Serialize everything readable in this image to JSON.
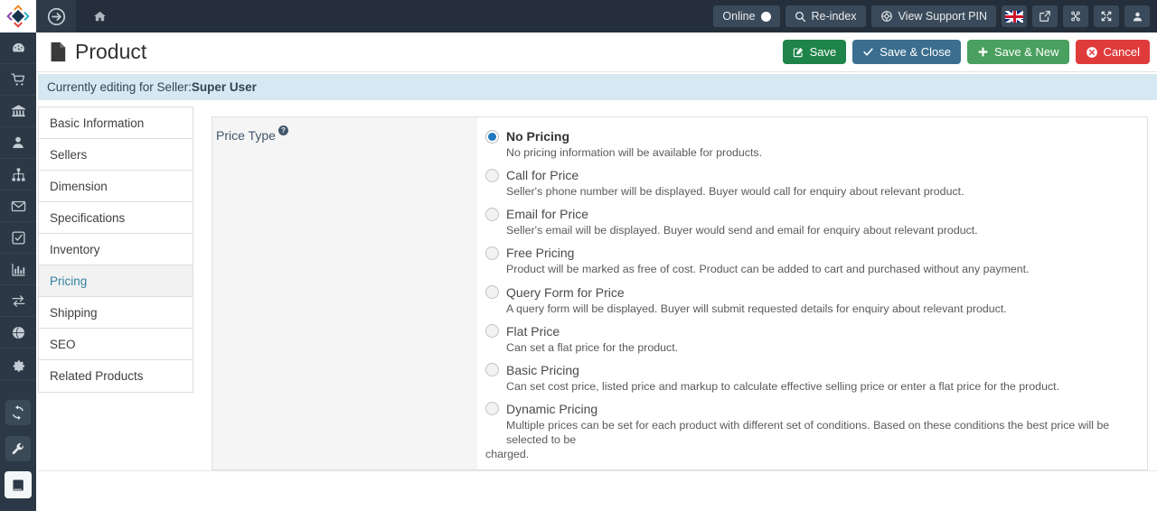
{
  "topbar": {
    "online_label": "Online",
    "reindex_label": "Re-index",
    "support_pin_label": "View Support PIN",
    "icons": {
      "forward": "arrow-circle-right-icon",
      "home": "home-icon",
      "search": "search-icon",
      "globe": "lifebuoy-icon",
      "flag": "uk-flag-icon",
      "external": "external-link-icon",
      "joomla": "joomla-icon",
      "expand": "expand-icon",
      "user": "user-icon"
    }
  },
  "header": {
    "title": "Product",
    "save_label": "Save",
    "save_close_label": "Save & Close",
    "save_new_label": "Save & New",
    "cancel_label": "Cancel"
  },
  "notice": {
    "prefix": "Currently editing for Seller: ",
    "seller": "Super User"
  },
  "rail": {
    "items": [
      {
        "name": "dashboard-icon"
      },
      {
        "name": "cart-icon"
      },
      {
        "name": "bank-icon"
      },
      {
        "name": "user-icon"
      },
      {
        "name": "sitemap-icon"
      },
      {
        "name": "envelope-icon"
      },
      {
        "name": "check-square-icon"
      },
      {
        "name": "bar-chart-icon"
      },
      {
        "name": "exchange-icon"
      },
      {
        "name": "globe-icon"
      },
      {
        "name": "gear-icon"
      },
      {
        "name": "refresh-icon"
      },
      {
        "name": "wrench-icon"
      },
      {
        "name": "book-icon"
      }
    ]
  },
  "tabs": {
    "items": [
      {
        "label": "Basic Information",
        "active": false
      },
      {
        "label": "Sellers",
        "active": false
      },
      {
        "label": "Dimension",
        "active": false
      },
      {
        "label": "Specifications",
        "active": false
      },
      {
        "label": "Inventory",
        "active": false
      },
      {
        "label": "Pricing",
        "active": true
      },
      {
        "label": "Shipping",
        "active": false
      },
      {
        "label": "SEO",
        "active": false
      },
      {
        "label": "Related Products",
        "active": false
      }
    ]
  },
  "pricing": {
    "field_label": "Price Type",
    "help_glyph": "?",
    "options": [
      {
        "label": "No Pricing",
        "description": "No pricing information will be available for products.",
        "selected": true
      },
      {
        "label": "Call for Price",
        "description": "Seller's phone number will be displayed. Buyer would call for enquiry about relevant product.",
        "selected": false
      },
      {
        "label": "Email for Price",
        "description": "Seller's email will be displayed. Buyer would send and email for enquiry about relevant product.",
        "selected": false
      },
      {
        "label": "Free Pricing",
        "description": "Product will be marked as free of cost. Product can be added to cart and purchased without any payment.",
        "selected": false
      },
      {
        "label": "Query Form for Price",
        "description": "A query form will be displayed. Buyer will submit requested details for enquiry about relevant product.",
        "selected": false
      },
      {
        "label": "Flat Price",
        "description": "Can set a flat price for the product.",
        "selected": false
      },
      {
        "label": "Basic Pricing",
        "description": "Can set cost price, listed price and markup to calculate effective selling price or enter a flat price for the product.",
        "selected": false
      },
      {
        "label": "Dynamic Pricing",
        "description": "Multiple prices can be set for each product with different set of conditions. Based on these conditions the best price will be selected to be",
        "description_tail": "charged.",
        "selected": false
      }
    ]
  },
  "colors": {
    "topbar_bg": "#242f3b",
    "rail_bg": "#2c3845",
    "accent_blue": "#1f78c1",
    "active_tab_text": "#3382a0",
    "notice_bg": "#d6e9f2",
    "save_green": "#1e8449",
    "save_close_blue": "#3c6e8f",
    "save_new_green": "#4aa05f",
    "cancel_red": "#e03b3b"
  }
}
